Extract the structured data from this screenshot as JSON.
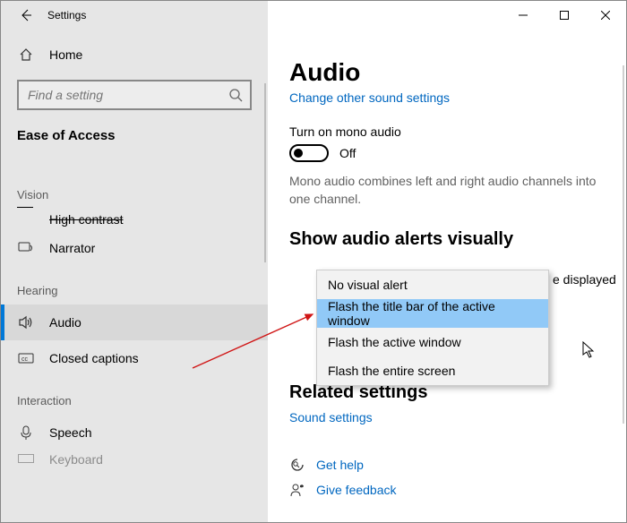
{
  "window": {
    "title": "Settings"
  },
  "sidebar": {
    "home_label": "Home",
    "search_placeholder": "Find a setting",
    "category_title": "Ease of Access",
    "vision_heading": "Vision",
    "high_contrast_label": "High contrast",
    "narrator_label": "Narrator",
    "hearing_heading": "Hearing",
    "audio_label": "Audio",
    "closed_captions_label": "Closed captions",
    "interaction_heading": "Interaction",
    "speech_label": "Speech",
    "keyboard_label": "Keyboard"
  },
  "main": {
    "heading": "Audio",
    "change_link": "Change other sound settings",
    "mono_label": "Turn on mono audio",
    "toggle_state": "Off",
    "mono_desc": "Mono audio combines left and right audio channels into one channel.",
    "alerts_heading": "Show audio alerts visually",
    "behind_fragment": "e displayed",
    "related_heading": "Related settings",
    "sound_settings_link": "Sound settings",
    "get_help": "Get help",
    "give_feedback": "Give feedback"
  },
  "dropdown": {
    "opt1": "No visual alert",
    "opt2": "Flash the title bar of the active window",
    "opt3": "Flash the active window",
    "opt4": "Flash the entire screen"
  }
}
